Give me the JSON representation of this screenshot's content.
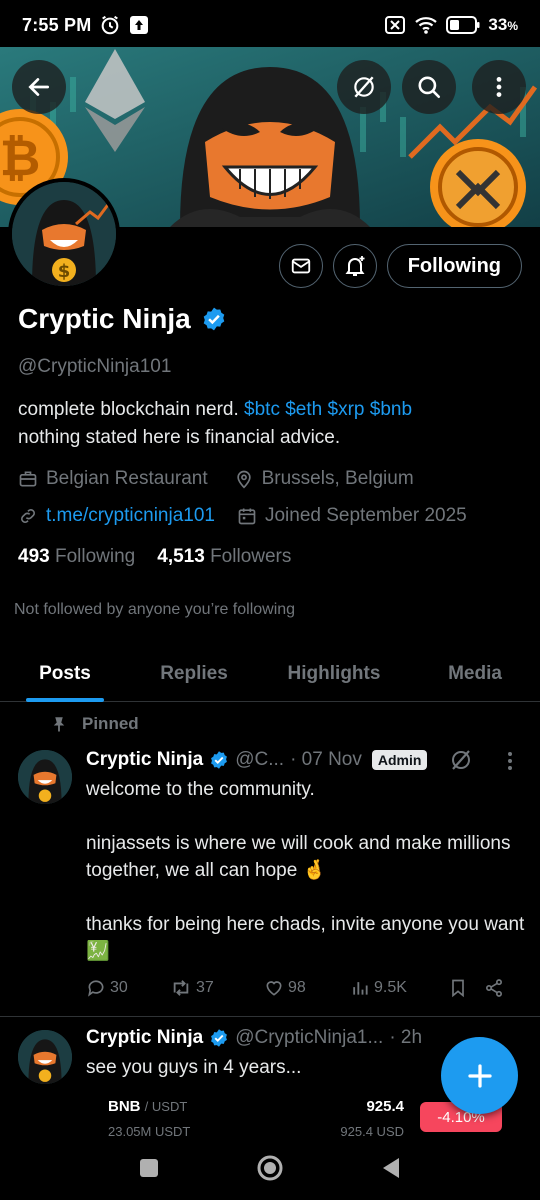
{
  "status_bar": {
    "time": "7:55 PM",
    "battery": "33",
    "battery_unit": "%"
  },
  "profile": {
    "name": "Cryptic Ninja",
    "handle": "@CrypticNinja101",
    "bio_line1_text": "complete blockchain nerd.",
    "bio_tags": [
      "$btc",
      "$eth",
      "$xrp",
      "$bnb"
    ],
    "bio_line2": "nothing stated here is financial advice.",
    "category": "Belgian Restaurant",
    "location": "Brussels, Belgium",
    "link": "t.me/crypticninja101",
    "joined": "Joined September 2025",
    "following_count": "493",
    "following_label": "Following",
    "followers_count": "4,513",
    "followers_label": "Followers",
    "not_followed": "Not followed by anyone you’re following",
    "follow_button": "Following"
  },
  "tabs": [
    "Posts",
    "Replies",
    "Highlights",
    "Media"
  ],
  "active_tab": "Posts",
  "pinned_label": "Pinned",
  "posts": [
    {
      "name": "Cryptic Ninja",
      "handle": "@C...",
      "time": "· 07 Nov",
      "badge": "Admin",
      "body": [
        "welcome to the community.",
        "",
        "ninjassets is where we will cook and make millions together, we all can hope 🤞",
        "",
        "thanks for being here chads, invite anyone you want 💹"
      ],
      "replies": "30",
      "reposts": "37",
      "likes": "98",
      "views": "9.5K"
    },
    {
      "name": "Cryptic Ninja",
      "handle": "@CrypticNinja1...",
      "time": "· 2h",
      "body": [
        "see you guys in 4 years..."
      ]
    }
  ],
  "ticker": {
    "symbol": "BNB",
    "pair": "/ USDT",
    "volume": "23.05M USDT",
    "price": "925.4",
    "price_usd": "925.4 USD",
    "change": "-4.10%"
  },
  "colors": {
    "accent": "#1d9bf0",
    "background": "#000000",
    "text_secondary": "#71767b",
    "negative": "#f6465d"
  }
}
